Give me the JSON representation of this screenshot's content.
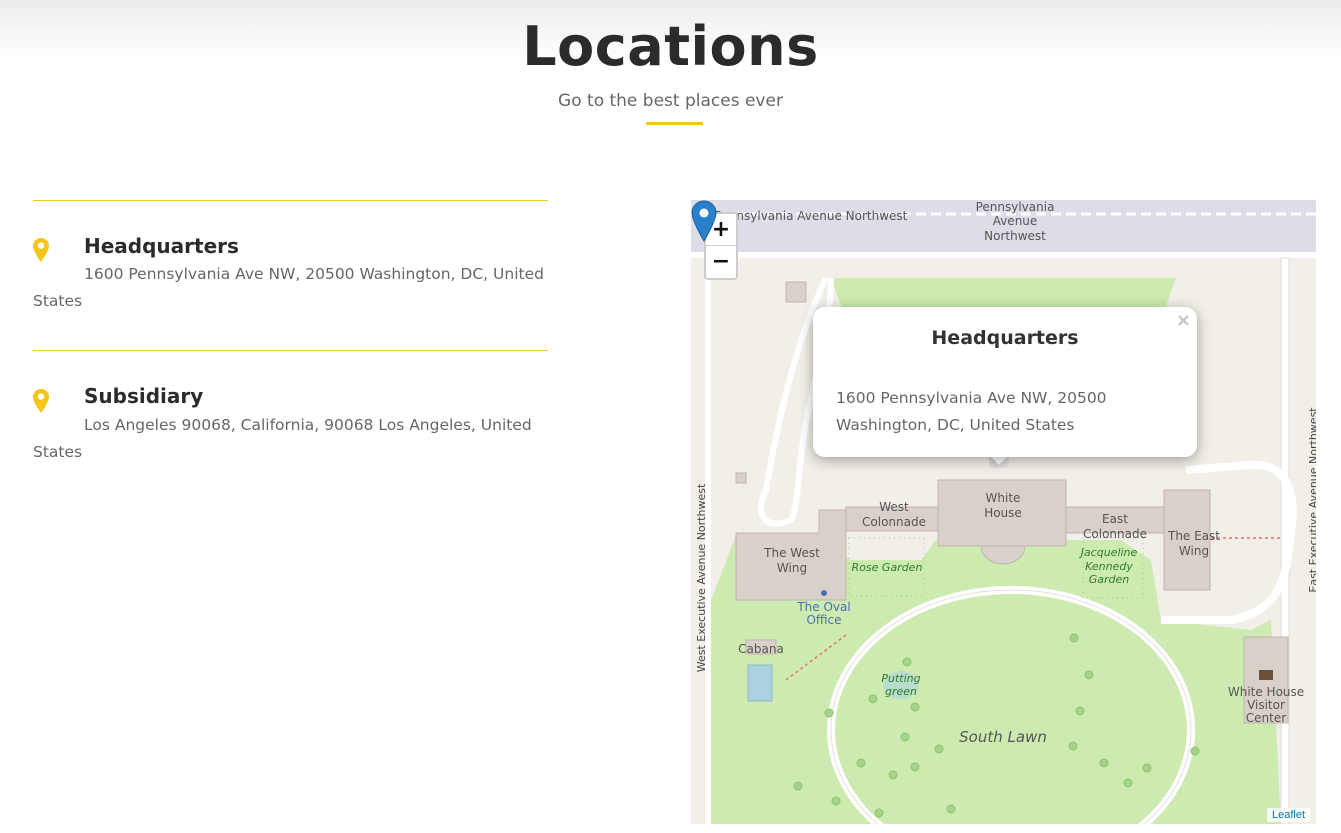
{
  "header": {
    "title": "Locations",
    "subtitle": "Go to the best places ever"
  },
  "locations": [
    {
      "name": "Headquarters",
      "address_line1": "1600 Pennsylvania Ave NW, 20500 Washington, DC, United",
      "address_line2": "States",
      "icon": "map-pin-icon"
    },
    {
      "name": "Subsidiary",
      "address_line1": "Los Angeles 90068, California, 90068 Los Angeles, United States",
      "icon": "map-pin-icon"
    }
  ],
  "map": {
    "zoom_in_label": "+",
    "zoom_out_label": "−",
    "popup": {
      "title": "Headquarters",
      "address_line1": "1600 Pennsylvania Ave NW, 20500",
      "address_line2": "Washington, DC, United States",
      "close_label": "×"
    },
    "attribution": "Leaflet",
    "labels": {
      "pa_ave_nw": "Pennsylvania Avenue Northwest",
      "pa_line1": "Pennsylvania",
      "pa_line2": "Avenue",
      "pa_line3": "Northwest",
      "white_house1": "White",
      "white_house2": "House",
      "west_colonnade1": "West",
      "west_colonnade2": "Colonnade",
      "east_colonnade1": "East",
      "east_colonnade2": "Colonnade",
      "west_wing1": "The West",
      "west_wing2": "Wing",
      "east_wing1": "The East",
      "east_wing2": "Wing",
      "rose_garden": "Rose Garden",
      "jk_garden1": "Jacqueline",
      "jk_garden2": "Kennedy",
      "jk_garden3": "Garden",
      "oval_office1": "The Oval",
      "oval_office2": "Office",
      "cabana": "Cabana",
      "putting_green1": "Putting",
      "putting_green2": "green",
      "south_lawn": "South Lawn",
      "visitor_center1": "White House",
      "visitor_center2": "Visitor",
      "visitor_center3": "Center",
      "west_exec_ave": "West Executive Avenue Northwest",
      "east_exec_ave": "East Executive Avenue Northwest"
    },
    "colors": {
      "lawn": "#cdebb0",
      "building": "#d9d0c9",
      "road": "#ffffff",
      "street": "#dddde8",
      "marker": "#2a81cb"
    }
  },
  "colors": {
    "accent": "#f5c518"
  }
}
